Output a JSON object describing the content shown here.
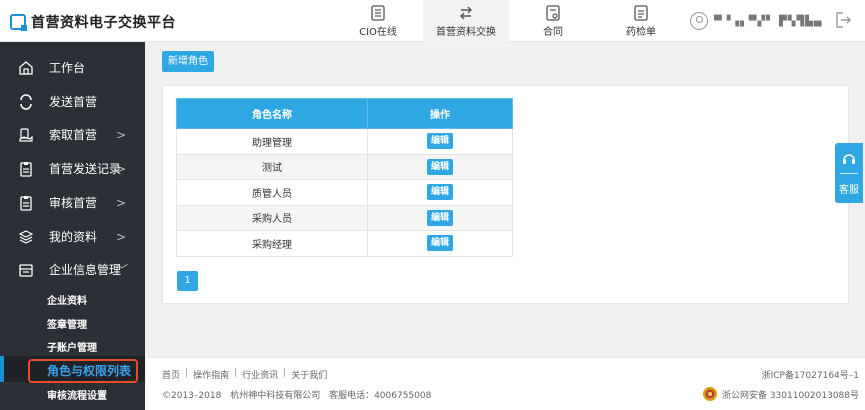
{
  "app": {
    "title": "首营资料电子交换平台"
  },
  "topnav": [
    {
      "label": "CIO在线",
      "icon": "document-icon"
    },
    {
      "label": "首营资料交换",
      "icon": "exchange-icon",
      "active": true
    },
    {
      "label": "合同",
      "icon": "contract-icon"
    },
    {
      "label": "药检单",
      "icon": "report-icon"
    }
  ],
  "user": {
    "name": "▀▝▗▖▀▞▘ ▛▚▜▙▄"
  },
  "sidebar": {
    "items": [
      {
        "label": "工作台",
        "icon": "home-icon",
        "chevron": ""
      },
      {
        "label": "发送首营",
        "icon": "sync-icon",
        "chevron": ""
      },
      {
        "label": "索取首营",
        "icon": "hand-icon",
        "chevron": ">"
      },
      {
        "label": "首营发送记录",
        "icon": "clipboard-icon",
        "chevron": ">"
      },
      {
        "label": "审核首营",
        "icon": "clipboard-icon",
        "chevron": ">"
      },
      {
        "label": "我的资料",
        "icon": "layers-icon",
        "chevron": ">"
      },
      {
        "label": "企业信息管理",
        "icon": "building-icon",
        "chevron": "﹀"
      }
    ],
    "sub_items": [
      {
        "label": "企业资料"
      },
      {
        "label": "签章管理"
      },
      {
        "label": "子账户管理"
      },
      {
        "label": "角色与权限列表",
        "active": true
      },
      {
        "label": "审核流程设置"
      }
    ]
  },
  "content": {
    "new_role_button": "新增角色",
    "table": {
      "headers": [
        "角色名称",
        "操作"
      ],
      "edit_label": "编辑",
      "rows": [
        "助理管理",
        "测试",
        "质管人员",
        "采购人员",
        "采购经理"
      ]
    },
    "pagination": {
      "current": "1"
    }
  },
  "float_service": {
    "label": "客服"
  },
  "footer": {
    "links": [
      "首页",
      "操作指南",
      "行业资讯",
      "关于我们"
    ],
    "copyright": "©2013–2018",
    "company": "杭州神中科技有限公司",
    "phone": "客服电话：4006755008",
    "icp": "浙ICP备17027164号–1",
    "police": "浙公网安备 33011002013088号"
  },
  "colors": {
    "accent": "#2fa7e3",
    "sidebar_bg": "#2c3036",
    "highlight": "#e84c2b"
  }
}
